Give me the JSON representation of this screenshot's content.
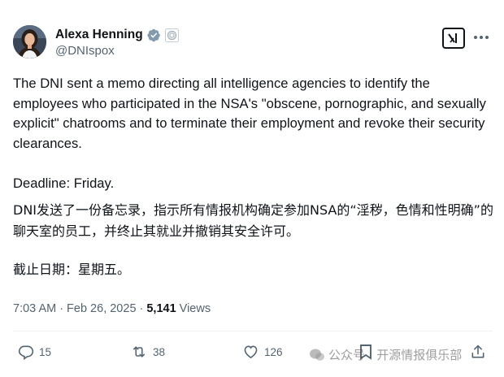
{
  "author": {
    "display_name": "Alexa Henning",
    "handle": "@DNIspox"
  },
  "post": {
    "text_en": "The DNI sent a memo directing all intelligence agencies to identify the employees who participated in the NSA's \"obscene, pornographic, and sexually explicit\" chatrooms and to terminate their employment and revoke their security clearances.",
    "deadline_en": "Deadline: Friday.",
    "text_zh": "DNI发送了一份备忘录，指示所有情报机构确定参加NSA的“淫秽，色情和性明确”的聊天室的员工，并终止其就业并撤销其安全许可。",
    "deadline_zh": "截止日期：星期五。"
  },
  "meta": {
    "time": "7:03 AM",
    "separator": "·",
    "date": "Feb 26, 2025",
    "views_count": "5,141",
    "views_label": "Views"
  },
  "actions": {
    "replies": "15",
    "reposts": "38",
    "likes": "126"
  },
  "watermark": {
    "text": "公众号 · 开源情报俱乐部"
  },
  "icons": {
    "verified": "verified-badge-icon",
    "affiliate": "gov-affiliate-badge-icon",
    "grok": "grok-icon",
    "more": "more-dots-icon",
    "reply": "reply-icon",
    "repost": "repost-icon",
    "like": "heart-icon",
    "bookmark": "bookmark-icon",
    "share": "share-icon"
  },
  "colors": {
    "text_primary": "#0f1419",
    "text_secondary": "#536471",
    "verified_badge": "#829aab",
    "divider": "#eff3f4"
  }
}
